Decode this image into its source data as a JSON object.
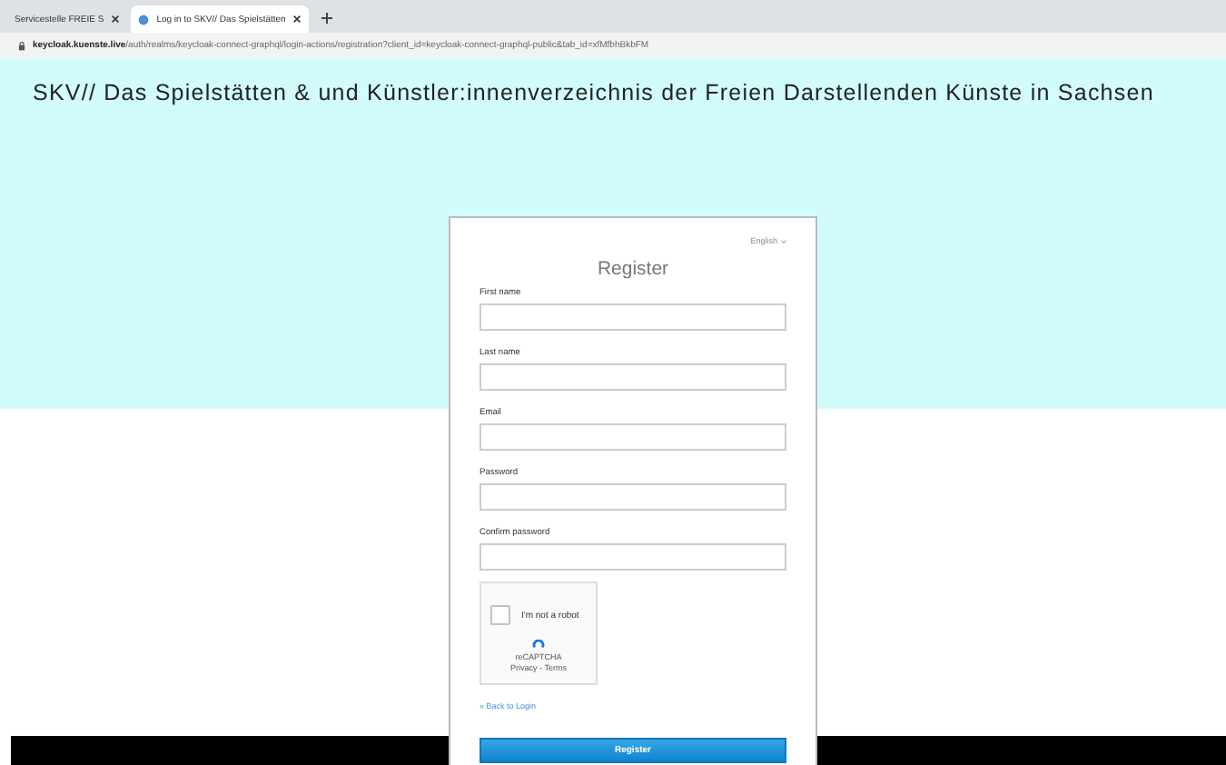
{
  "browser": {
    "tabs": [
      {
        "title": "Servicestelle FREIE S",
        "selected": false
      },
      {
        "title": "Log in to SKV// Das Spielstätten",
        "selected": true
      }
    ],
    "address": {
      "host": "keycloak.kuenste.live",
      "path": "/auth/realms/keycloak-connect-graphql/login-actions/registration?client_id=keycloak-connect-graphql-public&tab_id=xfMfbhBkbFM"
    }
  },
  "header": {
    "title": "SKV// Das Spielstätten & und Künstler:innenverzeichnis der Freien Darstellenden Künste in Sachsen"
  },
  "form": {
    "language": "English",
    "title": "Register",
    "fields": [
      {
        "label": "First name"
      },
      {
        "label": "Last name"
      },
      {
        "label": "Email"
      },
      {
        "label": "Password"
      },
      {
        "label": "Confirm password"
      }
    ],
    "captcha": {
      "label": "I'm not a robot",
      "checked": false,
      "brand": "reCAPTCHA",
      "links": "Privacy - Terms"
    },
    "back_link": "« Back to Login",
    "submit": "Register"
  }
}
